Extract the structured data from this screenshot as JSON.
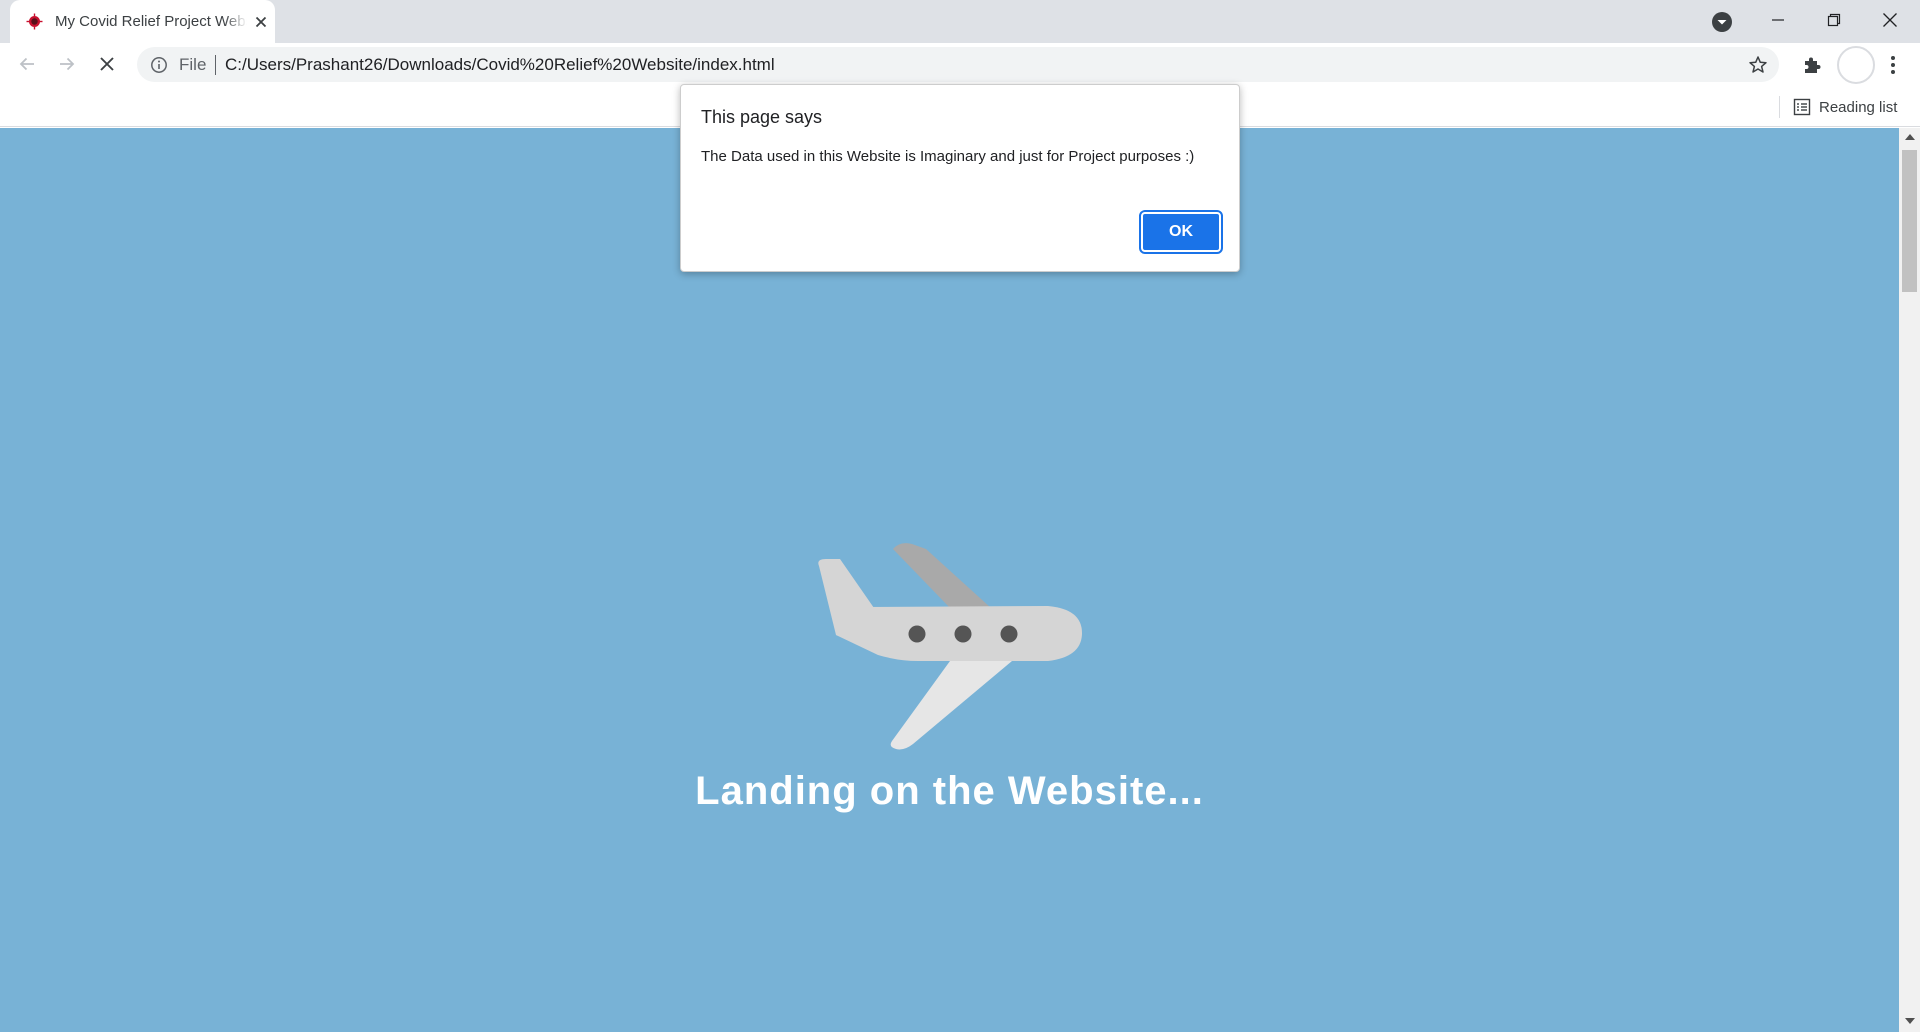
{
  "browser": {
    "tab": {
      "title": "My Covid Relief Project Website",
      "favicon": "covid-virus-icon"
    },
    "omnibox": {
      "scheme_label": "File",
      "url": "C:/Users/Prashant26/Downloads/Covid%20Relief%20Website/index.html"
    },
    "bookmarks": {
      "reading_list_label": "Reading list"
    },
    "icons": {
      "tab_close": "close-icon",
      "tab_search": "tab-search-icon",
      "minimize": "minimize-icon",
      "restore": "restore-icon",
      "close_window": "close-icon",
      "back": "back-arrow-icon",
      "forward": "forward-arrow-icon",
      "stop": "stop-loading-icon",
      "info": "info-icon",
      "star": "bookmark-star-icon",
      "extensions": "puzzle-icon",
      "profile": "profile-avatar-icon",
      "menu": "kebab-menu-icon",
      "reading_list": "reading-list-icon"
    }
  },
  "page": {
    "loading_text": "Landing on the Website...",
    "background_color": "#78b2d6",
    "illustration": "airplane-icon"
  },
  "dialog": {
    "title": "This page says",
    "message": "The Data used in this Website is Imaginary and just for Project purposes :)",
    "ok_label": "OK",
    "accent_color": "#1a73e8"
  }
}
